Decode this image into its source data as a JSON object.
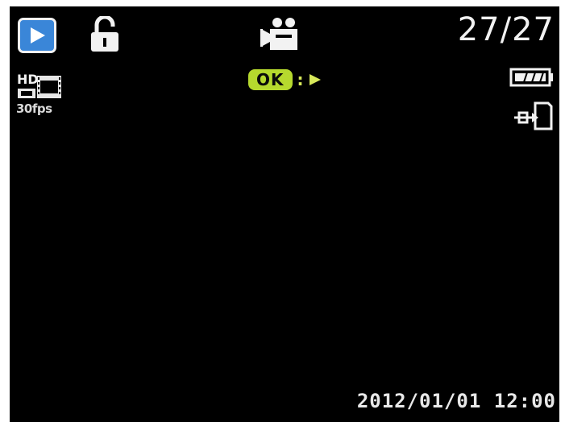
{
  "status": {
    "counter": "27/27",
    "ok_label": "OK",
    "ok_separator": ":",
    "fps_label": "30fps",
    "hd_label": "HD",
    "datetime": "2012/01/01 12:00"
  },
  "icons": {
    "mode": "playback-icon",
    "lock": "unlock-icon",
    "movie": "movie-camera-icon",
    "resolution": "hd-video-icon",
    "battery": "battery-full-icon",
    "output": "usb-connect-icon",
    "ok_action": "play-triangle-icon"
  },
  "colors": {
    "background": "#000000",
    "play_button": "#3a86d8",
    "ok_badge": "#b6d92e",
    "text": "#f2f2f2"
  }
}
